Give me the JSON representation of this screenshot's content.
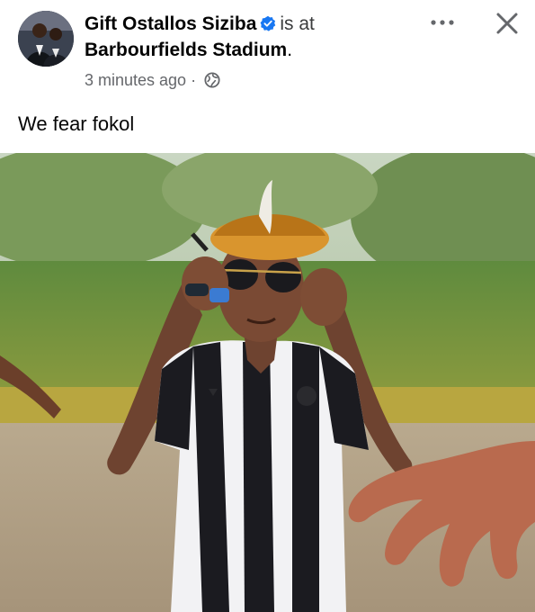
{
  "post": {
    "author": "Gift Ostallos Siziba",
    "checkin_prefix": "is at",
    "place": "Barbourfields Stadium",
    "place_suffix": ".",
    "time": "3 minutes ago",
    "separator": "·",
    "audience_icon": "globe-icon",
    "text": "We fear fokol"
  },
  "icons": {
    "verified": "verified-badge-icon",
    "more": "more-options-icon",
    "close": "close-icon"
  },
  "colors": {
    "verified_blue": "#1877f2",
    "meta_gray": "#65676b"
  }
}
